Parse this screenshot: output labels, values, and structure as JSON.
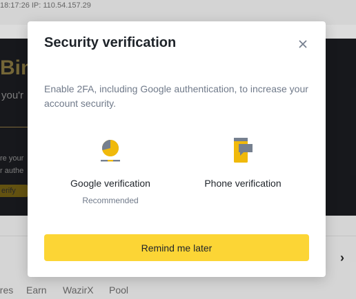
{
  "background": {
    "login_info": "18:17:26  IP: 110.54.157.29",
    "hero_title": "Bin",
    "hero_subtitle": "you'r",
    "note_line_1": "re your",
    "note_line_2": "r authe",
    "verify_button": "erify",
    "chevron": "›",
    "nav": [
      "ures",
      "Earn",
      "WazirX",
      "Pool"
    ]
  },
  "modal": {
    "title": "Security verification",
    "close_icon": "close-icon",
    "description": "Enable 2FA, including Google authentication, to increase your account security.",
    "options": [
      {
        "label": "Google verification",
        "sublabel": "Recommended",
        "icon": "google-authenticator-icon"
      },
      {
        "label": "Phone verification",
        "sublabel": "",
        "icon": "phone-message-icon"
      }
    ],
    "remind_button": "Remind me later"
  },
  "colors": {
    "accent": "#fcd535",
    "icon_yellow": "#f0b90b",
    "icon_gray": "#76808f",
    "text_primary": "#1e2329",
    "text_secondary": "#707a8a"
  }
}
